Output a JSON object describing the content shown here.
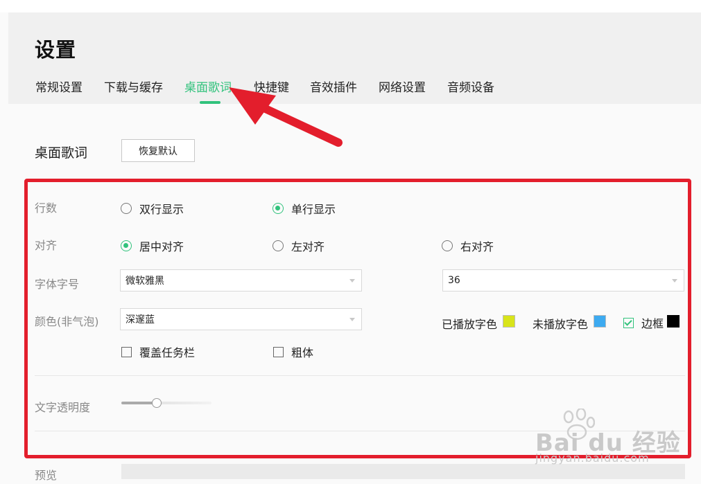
{
  "header": {
    "title": "设置",
    "tabs": [
      {
        "label": "常规设置",
        "active": false
      },
      {
        "label": "下载与缓存",
        "active": false
      },
      {
        "label": "桌面歌词",
        "active": true
      },
      {
        "label": "快捷键",
        "active": false
      },
      {
        "label": "音效插件",
        "active": false
      },
      {
        "label": "网络设置",
        "active": false
      },
      {
        "label": "音频设备",
        "active": false
      }
    ]
  },
  "section": {
    "title": "桌面歌词",
    "reset_label": "恢复默认"
  },
  "lines": {
    "label": "行数",
    "options": [
      {
        "label": "双行显示",
        "selected": false
      },
      {
        "label": "单行显示",
        "selected": true
      }
    ]
  },
  "align": {
    "label": "对齐",
    "options": [
      {
        "label": "居中对齐",
        "selected": true
      },
      {
        "label": "左对齐",
        "selected": false
      },
      {
        "label": "右对齐",
        "selected": false
      }
    ]
  },
  "font": {
    "label": "字体字号",
    "family_value": "微软雅黑",
    "size_value": "36"
  },
  "color": {
    "label": "颜色(非气泡)",
    "scheme_value": "深邃蓝",
    "played_label": "已播放字色",
    "played_color": "#d8e41a",
    "unplayed_label": "未播放字色",
    "unplayed_color": "#3daaf0",
    "border_label": "边框",
    "border_checked": true,
    "border_color": "#000000"
  },
  "options": {
    "cover_taskbar": {
      "label": "覆盖任务栏",
      "checked": false
    },
    "bold": {
      "label": "粗体",
      "checked": false
    }
  },
  "opacity": {
    "label": "文字透明度",
    "level": 0.4
  },
  "preview": {
    "label": "预览"
  },
  "accent_color": "#31c27c",
  "annotation_color": "#e31e2c",
  "watermark": {
    "brand": "Bai du 经验",
    "url": "jingyan.baidu.com"
  }
}
